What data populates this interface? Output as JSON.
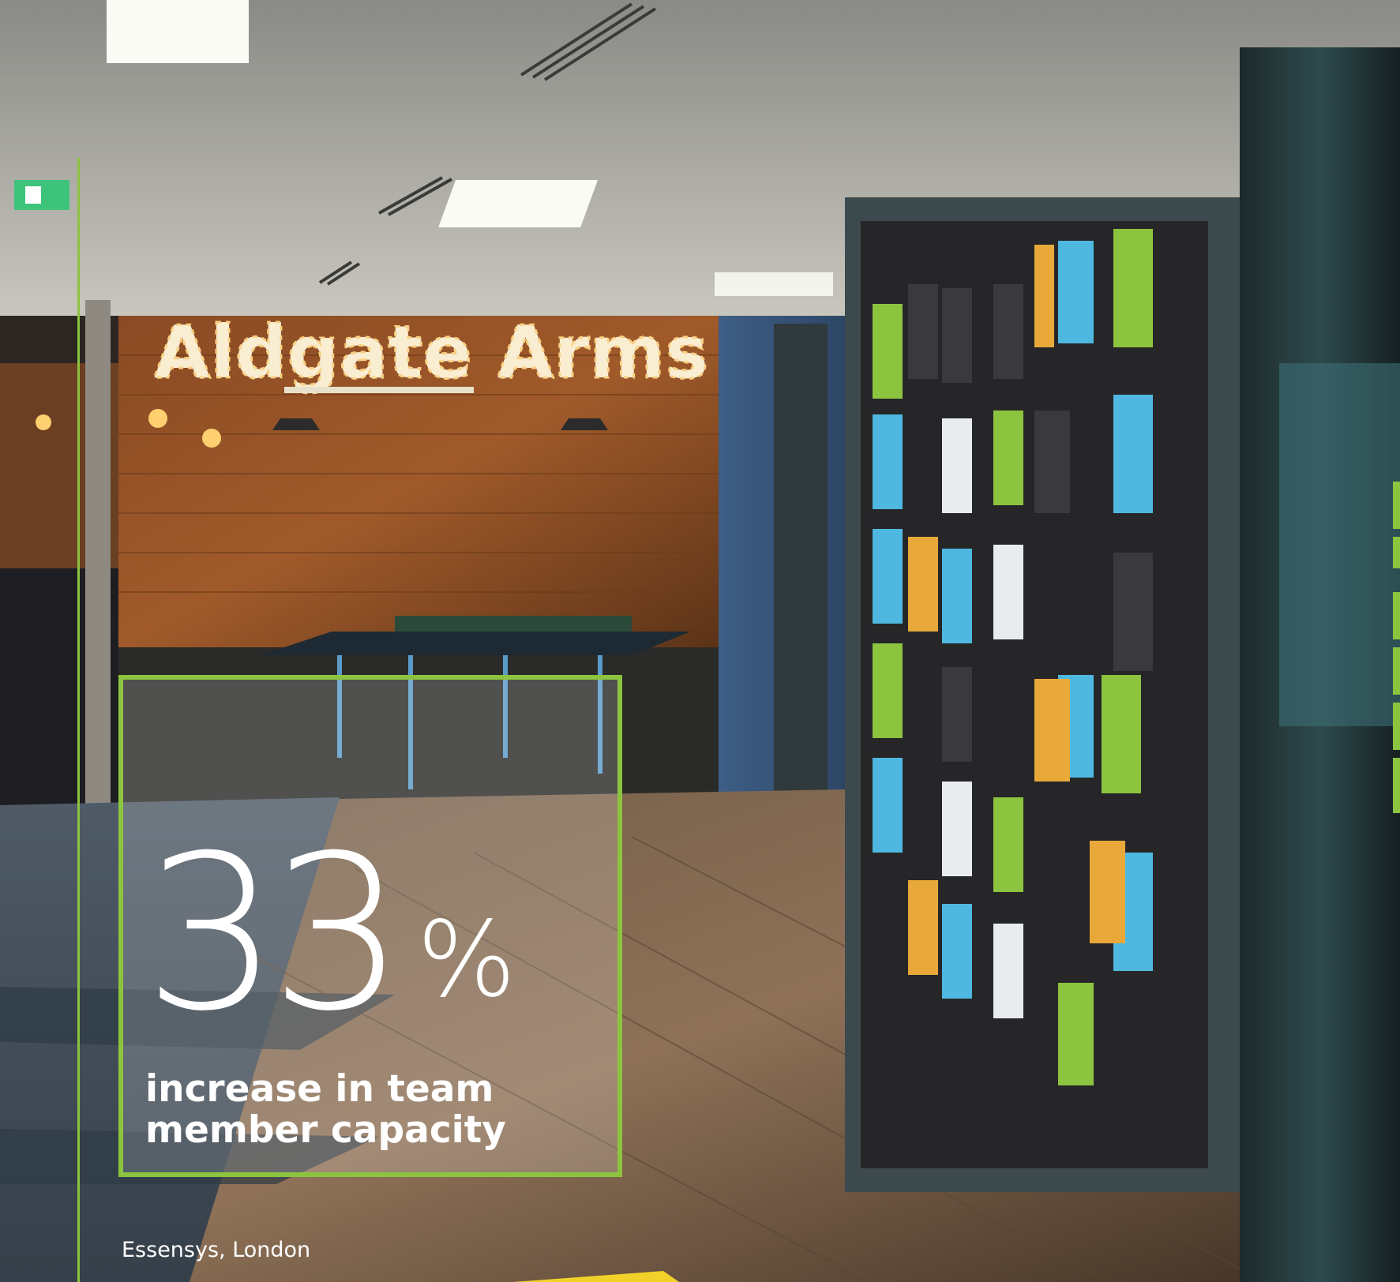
{
  "photo": {
    "sign_text": "Aldgate Arms",
    "stat": {
      "number": "33",
      "unit": "%",
      "caption": "increase in team member capacity"
    },
    "location_caption": "Essensys, London",
    "accent_color": "#8cc43f"
  }
}
